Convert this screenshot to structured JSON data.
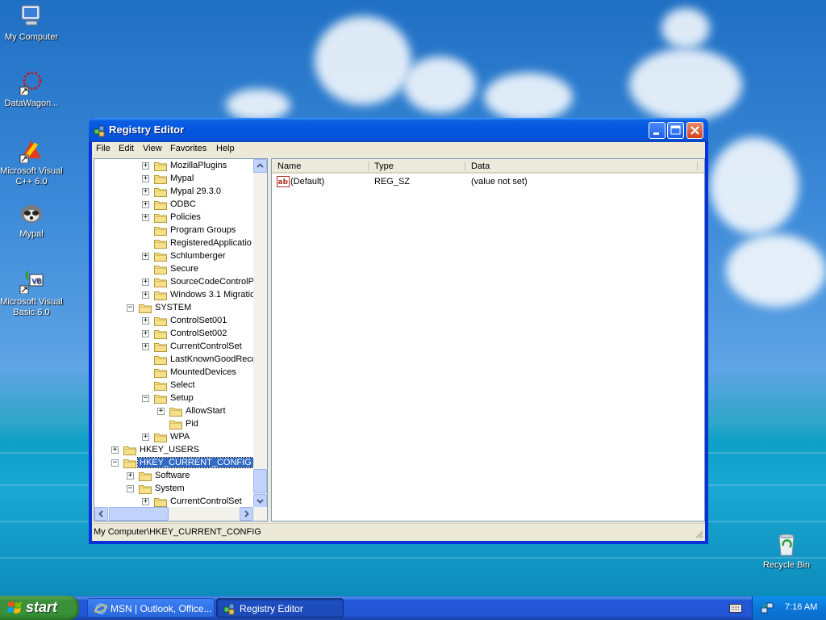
{
  "desktop": {
    "icons": [
      {
        "label": "My Computer",
        "icon": "my-computer-icon"
      },
      {
        "label": "DataWagon...",
        "icon": "datawagon-icon"
      },
      {
        "label": "Microsoft Visual C++ 6.0",
        "icon": "visual-cpp-icon"
      },
      {
        "label": "Mypal",
        "icon": "mypal-icon"
      },
      {
        "label": "Microsoft Visual Basic 6.0",
        "icon": "visual-basic-icon"
      },
      {
        "label": "Recycle Bin",
        "icon": "recycle-bin-icon"
      }
    ]
  },
  "window": {
    "title": "Registry Editor",
    "menu": [
      "File",
      "Edit",
      "View",
      "Favorites",
      "Help"
    ],
    "tree": [
      {
        "label": "MozillaPlugins",
        "expander": "+",
        "level": 3
      },
      {
        "label": "Mypal",
        "expander": "+",
        "level": 3
      },
      {
        "label": "Mypal 29.3.0",
        "expander": "+",
        "level": 3
      },
      {
        "label": "ODBC",
        "expander": "+",
        "level": 3
      },
      {
        "label": "Policies",
        "expander": "+",
        "level": 3
      },
      {
        "label": "Program Groups",
        "expander": "",
        "level": 3
      },
      {
        "label": "RegisteredApplicatio",
        "expander": "",
        "level": 3
      },
      {
        "label": "Schlumberger",
        "expander": "+",
        "level": 3
      },
      {
        "label": "Secure",
        "expander": "",
        "level": 3
      },
      {
        "label": "SourceCodeControlPr",
        "expander": "+",
        "level": 3
      },
      {
        "label": "Windows 3.1 Migratic",
        "expander": "+",
        "level": 3
      },
      {
        "label": "SYSTEM",
        "expander": "-",
        "level": 2
      },
      {
        "label": "ControlSet001",
        "expander": "+",
        "level": 3
      },
      {
        "label": "ControlSet002",
        "expander": "+",
        "level": 3
      },
      {
        "label": "CurrentControlSet",
        "expander": "+",
        "level": 3
      },
      {
        "label": "LastKnownGoodReco",
        "expander": "",
        "level": 3
      },
      {
        "label": "MountedDevices",
        "expander": "",
        "level": 3
      },
      {
        "label": "Select",
        "expander": "",
        "level": 3
      },
      {
        "label": "Setup",
        "expander": "-",
        "level": 3
      },
      {
        "label": "AllowStart",
        "expander": "+",
        "level": 4
      },
      {
        "label": "Pid",
        "expander": "",
        "level": 4
      },
      {
        "label": "WPA",
        "expander": "+",
        "level": 3
      },
      {
        "label": "HKEY_USERS",
        "expander": "+",
        "level": 1
      },
      {
        "label": "HKEY_CURRENT_CONFIG",
        "expander": "-",
        "level": 1,
        "selected": true
      },
      {
        "label": "Software",
        "expander": "+",
        "level": 2
      },
      {
        "label": "System",
        "expander": "-",
        "level": 2
      },
      {
        "label": "CurrentControlSet",
        "expander": "+",
        "level": 3
      }
    ],
    "list": {
      "columns": [
        "Name",
        "Type",
        "Data"
      ],
      "rows": [
        {
          "name": "(Default)",
          "type": "REG_SZ",
          "data": "(value not set)",
          "icon": "string-value-icon"
        }
      ]
    },
    "status": "My Computer\\HKEY_CURRENT_CONFIG"
  },
  "taskbar": {
    "start_label": "start",
    "tasks": [
      {
        "label": "MSN | Outlook, Office...",
        "icon": "internet-explorer-icon",
        "active": false
      },
      {
        "label": "Registry Editor",
        "icon": "registry-editor-icon",
        "active": true
      }
    ],
    "clock": "7:16 AM"
  }
}
